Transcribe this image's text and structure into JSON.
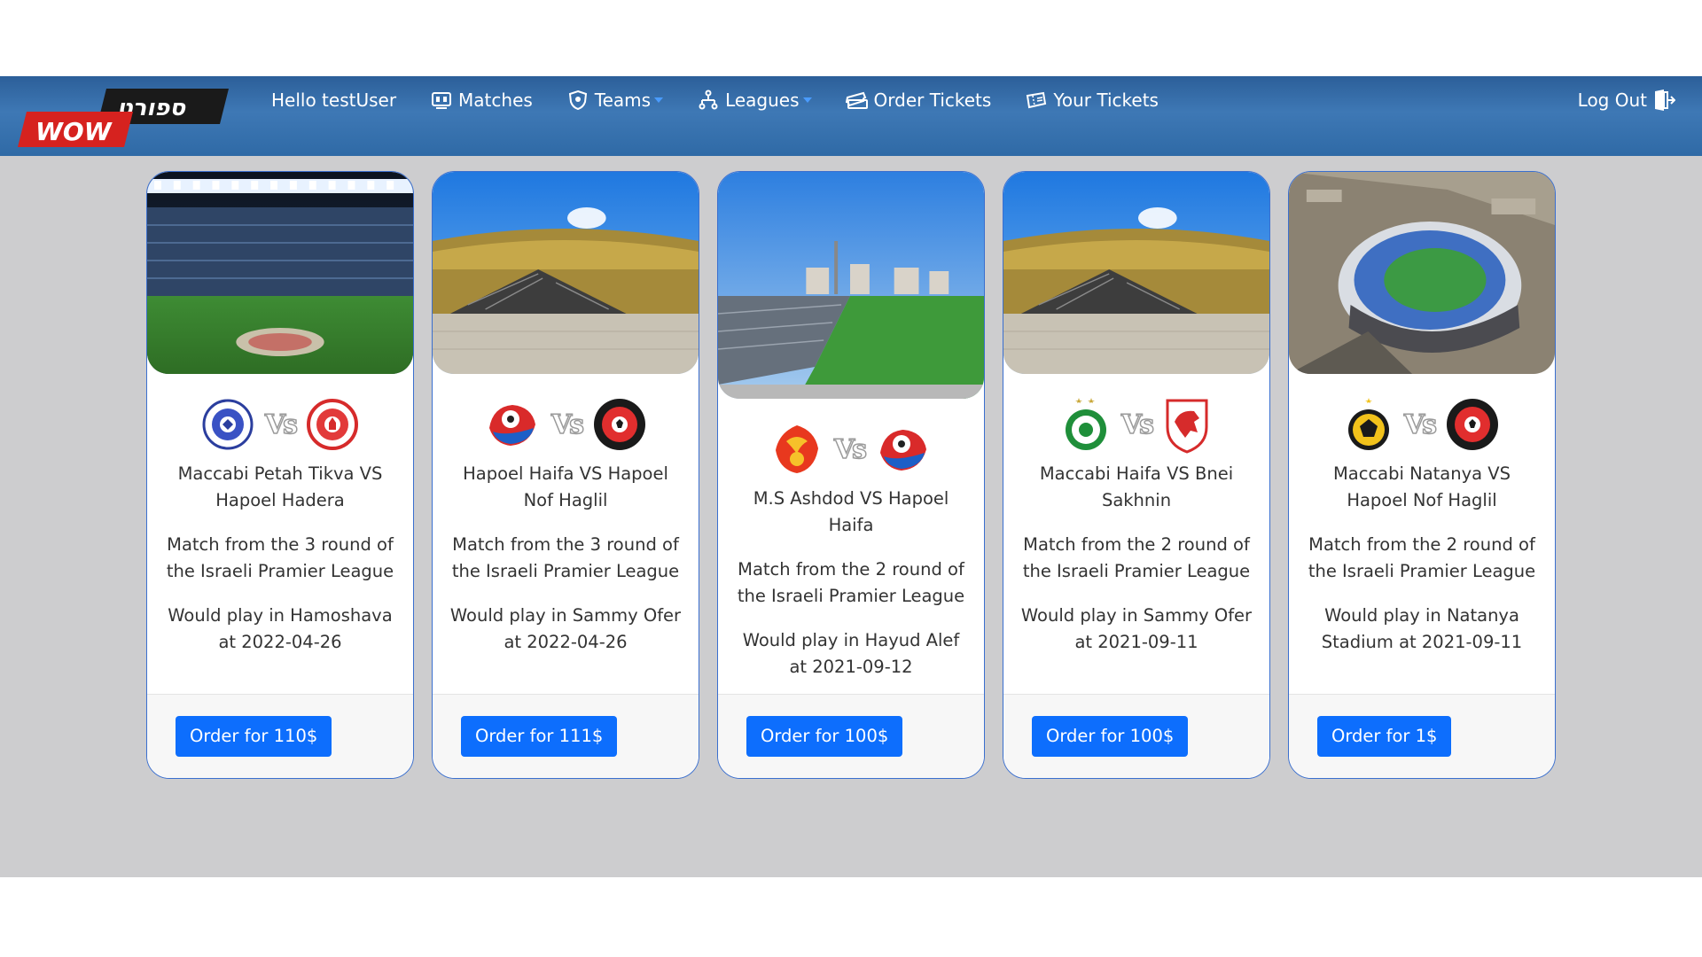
{
  "navbar": {
    "logo_text_top": "ספורט",
    "logo_text_bottom": "WOW",
    "greeting": "Hello testUser",
    "items": [
      {
        "label": "Matches",
        "icon": "matches-icon",
        "dropdown": false
      },
      {
        "label": "Teams",
        "icon": "teams-icon",
        "dropdown": true
      },
      {
        "label": "Leagues",
        "icon": "leagues-icon",
        "dropdown": true
      },
      {
        "label": "Order Tickets",
        "icon": "order-tickets-icon",
        "dropdown": false
      },
      {
        "label": "Your Tickets",
        "icon": "your-tickets-icon",
        "dropdown": false
      }
    ],
    "logout": "Log Out"
  },
  "colors": {
    "navbar": "#3e78b5",
    "background": "#cdcdcf",
    "card_border": "#3a6fcf",
    "button": "#0d6efd"
  },
  "matches": [
    {
      "home_logo": "maccabi-petah-tikva-logo",
      "away_logo": "hapoel-hadera-logo",
      "vs": "Vs",
      "title": "Maccabi Petah Tikva VS Hapoel Hadera",
      "description": "Match from the 3 round of the Israeli Pramier League",
      "venue": "Would play in Hamoshava at 2022-04-26",
      "order_label": "Order for 110$",
      "image": "stadium-night"
    },
    {
      "home_logo": "hapoel-haifa-logo",
      "away_logo": "hapoel-nof-haglil-logo",
      "vs": "Vs",
      "title": "Hapoel Haifa VS Hapoel Nof Haglil",
      "description": "Match from the 3 round of the Israeli Pramier League",
      "venue": "Would play in Sammy Ofer at 2022-04-26",
      "order_label": "Order for 111$",
      "image": "sammy-ofer-stadium"
    },
    {
      "home_logo": "ms-ashdod-logo",
      "away_logo": "hapoel-haifa-logo",
      "vs": "Vs",
      "title": "M.S Ashdod VS Hapoel Haifa",
      "description": "Match from the 2 round of the Israeli Pramier League",
      "venue": "Would play in Hayud Alef at 2021-09-12",
      "order_label": "Order for 100$",
      "image": "hayud-alef-stadium"
    },
    {
      "home_logo": "maccabi-haifa-logo",
      "away_logo": "bnei-sakhnin-logo",
      "vs": "Vs",
      "title": "Maccabi Haifa VS Bnei Sakhnin",
      "description": "Match from the 2 round of the Israeli Pramier League",
      "venue": "Would play in Sammy Ofer at 2021-09-11",
      "order_label": "Order for 100$",
      "image": "sammy-ofer-stadium"
    },
    {
      "home_logo": "maccabi-natanya-logo",
      "away_logo": "hapoel-nof-haglil-logo",
      "vs": "Vs",
      "title": "Maccabi Natanya VS Hapoel Nof Haglil",
      "description": "Match from the 2 round of the Israeli Pramier League",
      "venue": "Would play in Natanya Stadium at 2021-09-11",
      "order_label": "Order for 1$",
      "image": "natanya-stadium-aerial"
    }
  ]
}
